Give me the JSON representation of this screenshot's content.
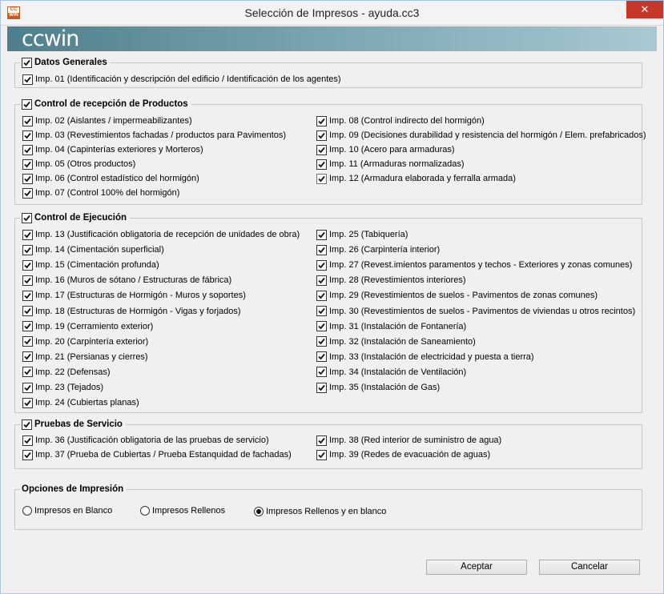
{
  "window": {
    "title": "Selección de Impresos - ayuda.cc3",
    "close_label": "✕",
    "icon_top": "CC",
    "icon_bottom": "WIN"
  },
  "banner": {
    "logo": "ccwin"
  },
  "sections": {
    "datos_generales": {
      "title": "Datos Generales",
      "items": [
        "Imp. 01 (Identificación y descripción del edificio / Identificación de los agentes)"
      ]
    },
    "control_recepcion": {
      "title": "Control  de recepción de Productos",
      "left": [
        "Imp. 02 (Aislantes / impermeabilizantes)",
        "Imp. 03 (Revestimientos fachadas / productos para Pavimentos)",
        "Imp. 04 (Capinterías exteriores y Morteros)",
        "Imp. 05 (Otros productos)",
        "Imp. 06 (Control estadístico del hormigón)",
        "Imp. 07 (Control 100% del hormigón)"
      ],
      "right": [
        "Imp. 08 (Control indirecto del hormigón)",
        "Imp. 09 (Decisiones durabilidad y resistencia del hormigón / Elem. prefabricados)",
        "Imp. 10 (Acero para armaduras)",
        "Imp. 11 (Armaduras normalizadas)",
        "Imp. 12 (Armadura elaborada y ferralla armada)"
      ]
    },
    "control_ejecucion": {
      "title": "Control de Ejecución",
      "left": [
        "Imp. 13 (Justificación obligatoria de recepción de unidades de obra)",
        "Imp. 14 (Cimentación superficial)",
        "Imp. 15 (Cimentación profunda)",
        "Imp. 16 (Muros de sótano / Estructuras de fábrica)",
        "Imp. 17 (Estructuras de Hormigón - Muros y soportes)",
        "Imp. 18 (Estructuras de Hormigón - Vigas y forjados)",
        "Imp. 19 (Cerramiento exterior)",
        "Imp. 20 (Carpintería exterior)",
        "Imp. 21 (Persianas y cierres)",
        "Imp. 22 (Defensas)",
        "Imp. 23 (Tejados)",
        "Imp. 24 (Cubiertas planas)"
      ],
      "right": [
        "Imp. 25 (Tabiquería)",
        "Imp. 26 (Carpintería interior)",
        "Imp. 27 (Revest.imientos paramentos y techos - Exteriores y zonas comunes)",
        "Imp. 28 (Revestimientos interiores)",
        "Imp. 29 (Revestimientos de suelos - Pavimentos de zonas comunes)",
        "Imp. 30 (Revestimientos de suelos - Pavimentos de viviendas u otros recintos)",
        "Imp. 31 (Instalación de Fontanería)",
        "Imp. 32 (Instalación de Saneamiento)",
        "Imp. 33 (Instalación de electricidad y puesta a tierra)",
        "Imp. 34 (Instalación de Ventilación)",
        "Imp. 35 (Instalación de Gas)"
      ]
    },
    "pruebas_servicio": {
      "title": "Pruebas de Servicio",
      "left": [
        "Imp. 36 (Justificación obligatoria de las pruebas de servicio)",
        "Imp. 37 (Prueba de Cubiertas / Prueba Estanquidad de fachadas)"
      ],
      "right": [
        "Imp. 38 (Red interior de suministro de agua)",
        "Imp. 39 (Redes de evacuación de aguas)"
      ]
    },
    "opciones": {
      "title": "Opciones de Impresión",
      "options": [
        "Impresos en Blanco",
        "Impresos Rellenos",
        "Impresos Rellenos y en blanco"
      ],
      "selected": "Impresos Rellenos y en blanco"
    }
  },
  "buttons": {
    "accept": "Aceptar",
    "cancel": "Cancelar"
  }
}
